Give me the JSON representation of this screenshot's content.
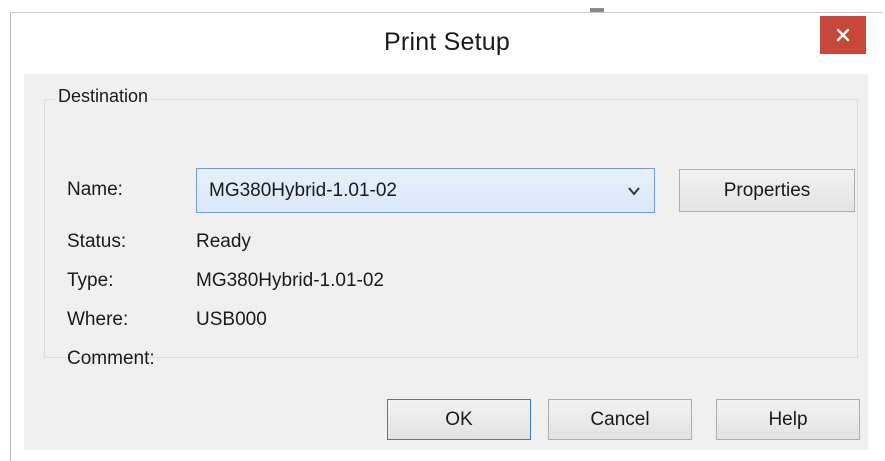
{
  "dialog": {
    "title": "Print Setup",
    "close_glyph": "✕"
  },
  "destination": {
    "group_label": "Destination",
    "name_label": "Name:",
    "name_value": "MG380Hybrid-1.01-02",
    "properties_label": "Properties",
    "status_label": "Status:",
    "status_value": "Ready",
    "type_label": "Type:",
    "type_value": "MG380Hybrid-1.01-02",
    "where_label": "Where:",
    "where_value": "USB000",
    "comment_label": "Comment:",
    "comment_value": ""
  },
  "buttons": {
    "ok": "OK",
    "cancel": "Cancel",
    "help": "Help"
  },
  "colors": {
    "close_button": "#c7483b",
    "select_border": "#6f9dd3",
    "default_button_border": "#3c7fb1"
  },
  "icons": {
    "close": "close-icon",
    "dropdown": "chevron-down-icon"
  }
}
